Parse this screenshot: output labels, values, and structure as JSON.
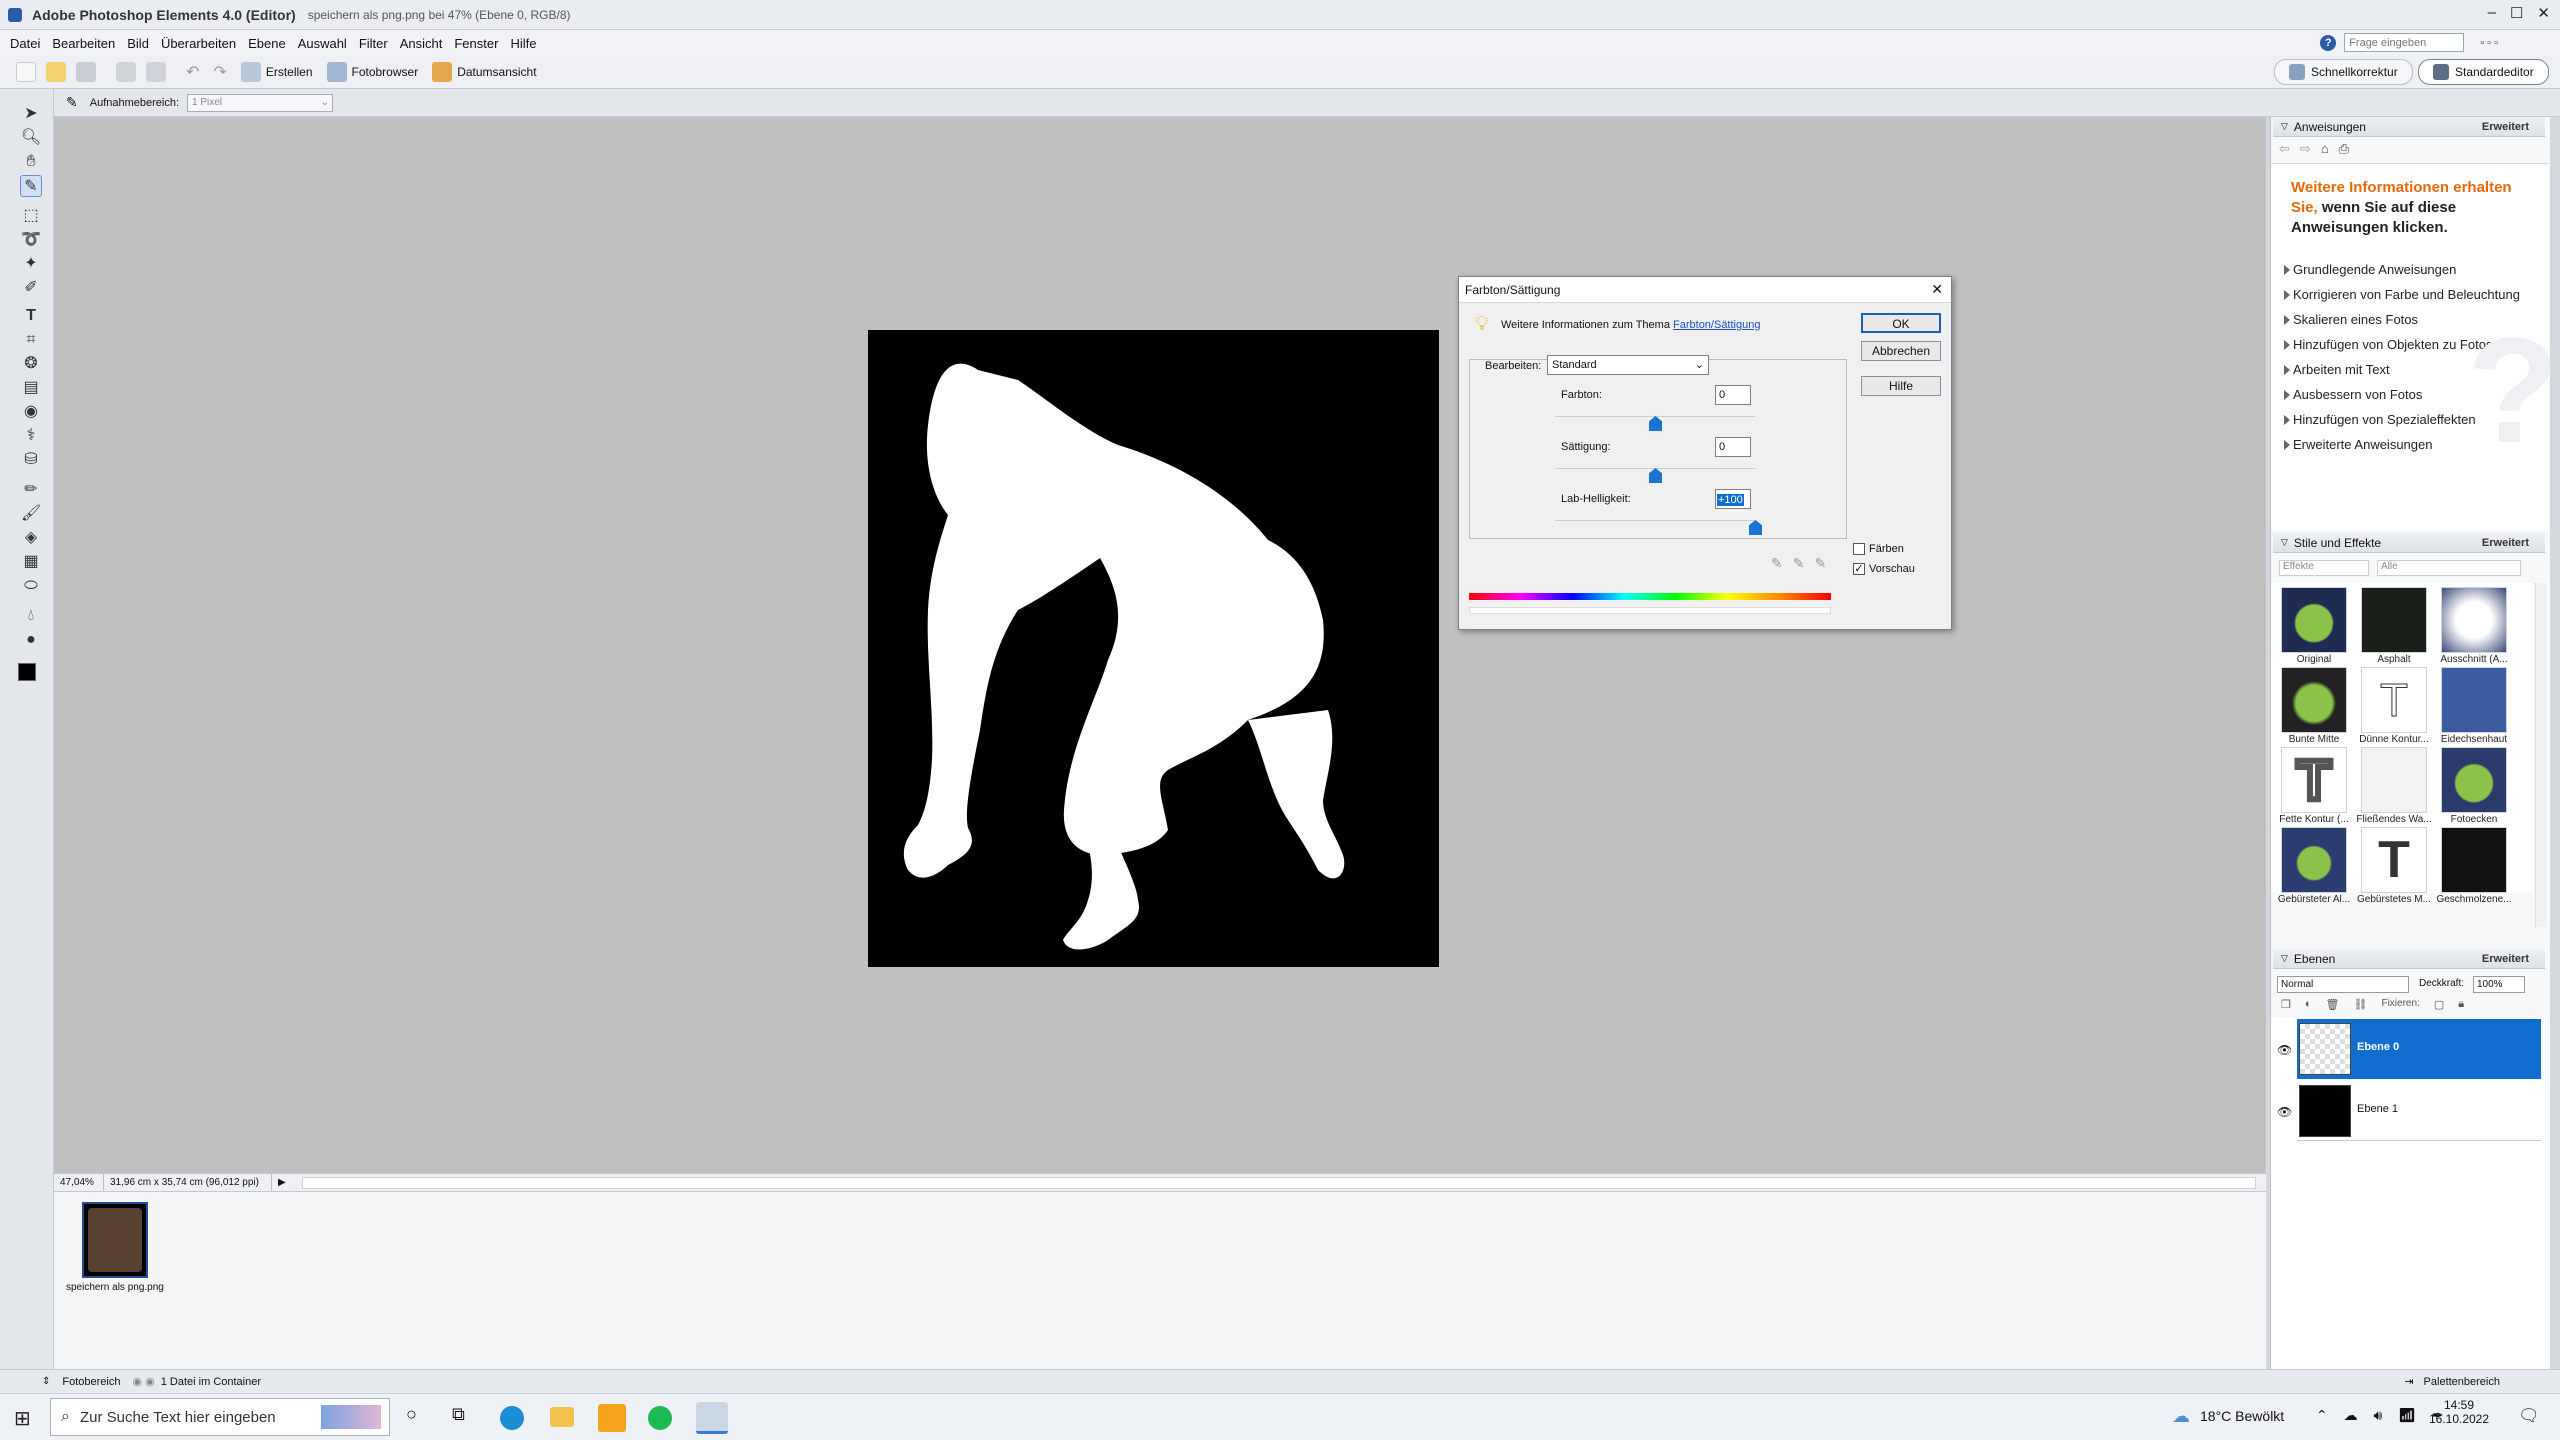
{
  "title_bar": {
    "app": "Adobe Photoshop Elements 4.0 (Editor)",
    "document": "speichern als png.png bei 47% (Ebene 0, RGB/8)"
  },
  "menu": [
    "Datei",
    "Bearbeiten",
    "Bild",
    "Überarbeiten",
    "Ebene",
    "Auswahl",
    "Filter",
    "Ansicht",
    "Fenster",
    "Hilfe"
  ],
  "help_search_placeholder": "Frage eingeben",
  "shortcuts": {
    "create": "Erstellen",
    "photo_browser": "Fotobrowser",
    "date_view": "Datumsansicht",
    "quick_fix": "Schnellkorrektur",
    "standard_editor": "Standardeditor"
  },
  "options_bar": {
    "label": "Aufnahmebereich:",
    "value": "1 Pixel"
  },
  "status": {
    "zoom": "47,04%",
    "doc_size": "31,96 cm x 35,74 cm (96,012 ppi)"
  },
  "photo_bin": {
    "file": "speichern als png.png",
    "label": "Fotobereich",
    "count": "1 Datei im Container"
  },
  "palette_bin_label": "Palettenbereich",
  "how_to": {
    "title": "Anweisungen",
    "advanced": "Erweitert",
    "info_orange": "Weitere Informationen erhalten Sie,",
    "info_dark": "wenn Sie auf diese Anweisungen klicken.",
    "links": [
      "Grundlegende Anweisungen",
      "Korrigieren von Farbe und Beleuchtung",
      "Skalieren eines Fotos",
      "Hinzufügen von Objekten zu Fotos",
      "Arbeiten mit Text",
      "Ausbessern von Fotos",
      "Hinzufügen von Spezialeffekten",
      "Erweiterte Anweisungen"
    ]
  },
  "styles": {
    "title": "Stile und Effekte",
    "advanced": "Erweitert",
    "filter1": "Effekte",
    "filter2": "Alle",
    "items": [
      "Original",
      "Asphalt",
      "Ausschnitt (A...",
      "Bunte Mitte",
      "Dünne Kontur...",
      "Eidechsenhaut",
      "Fette Kontur (...",
      "Fließendes Wa...",
      "Fotoecken",
      "Gebürsteter Al...",
      "Gebürstetes M...",
      "Geschmolzene..."
    ]
  },
  "layers": {
    "title": "Ebenen",
    "advanced": "Erweitert",
    "mode": "Normal",
    "opacity_label": "Deckkraft:",
    "opacity": "100%",
    "lock_label": "Fixieren:",
    "items": [
      "Ebene 0",
      "Ebene 1"
    ]
  },
  "dialog": {
    "title": "Farbton/Sättigung",
    "info_prefix": "Weitere Informationen zum Thema",
    "info_link": "Farbton/Sättigung",
    "edit_label": "Bearbeiten:",
    "edit_value": "Standard",
    "hue_label": "Farbton:",
    "hue": "0",
    "sat_label": "Sättigung:",
    "sat": "0",
    "light_label": "Lab-Helligkeit:",
    "light": "+100",
    "ok": "OK",
    "cancel": "Abbrechen",
    "help": "Hilfe",
    "colorize": "Färben",
    "preview": "Vorschau",
    "hue_level": 0,
    "sat_level": 0,
    "light_level": 100
  },
  "taskbar": {
    "search_placeholder": "Zur Suche Text hier eingeben",
    "weather": "18°C Bewölkt",
    "time": "14:59",
    "date": "16.10.2022"
  }
}
